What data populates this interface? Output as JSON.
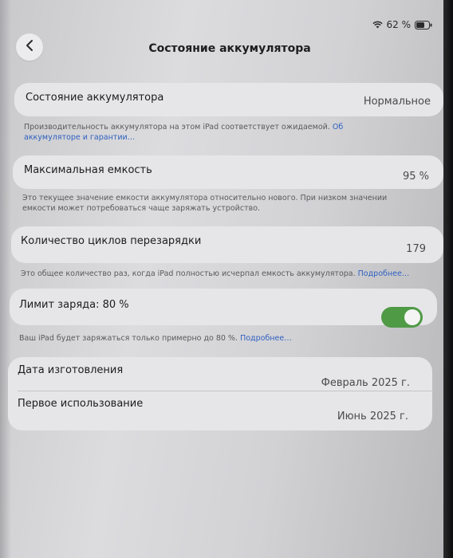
{
  "status": {
    "battery_percent": "62 %"
  },
  "header": {
    "title": "Состояние аккумулятора"
  },
  "health": {
    "label": "Состояние аккумулятора",
    "value": "Нормальное",
    "note": "Производительность аккумулятора на этом iPad соответствует ожидаемой. ",
    "link": "Об аккумуляторе и гарантии…"
  },
  "capacity": {
    "label": "Максимальная емкость",
    "value": "95 %",
    "note": "Это текущее значение емкости аккумулятора относительно нового. При низком значении емкости может потребоваться чаще заряжать устройство."
  },
  "cycles": {
    "label": "Количество циклов перезарядки",
    "value": "179",
    "note": "Это общее количество раз, когда iPad полностью исчерпал емкость аккумулятора. ",
    "link": "Подробнее…"
  },
  "limit": {
    "label": "Лимит заряда: 80 %",
    "note": "Ваш iPad будет заряжаться только примерно до 80 %. ",
    "link": "Подробнее…",
    "toggle_on": true
  },
  "dates": {
    "manufacture_label": "Дата изготовления",
    "manufacture_value": "Февраль 2025 г.",
    "first_use_label": "Первое использование",
    "first_use_value": "Июнь 2025 г."
  },
  "colors": {
    "toggle_on": "#4f9a45",
    "link": "#2e5fbf"
  }
}
